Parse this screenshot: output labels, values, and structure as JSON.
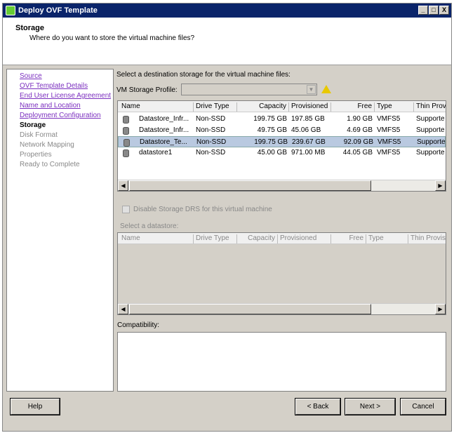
{
  "window": {
    "title": "Deploy OVF Template",
    "controls": [
      "_",
      "□",
      "X"
    ]
  },
  "header": {
    "title": "Storage",
    "subtitle": "Where do you want to store the virtual machine files?"
  },
  "nav": {
    "items": [
      {
        "label": "Source",
        "state": "link"
      },
      {
        "label": "OVF Template Details",
        "state": "link"
      },
      {
        "label": "End User License Agreement",
        "state": "link"
      },
      {
        "label": "Name and Location",
        "state": "link"
      },
      {
        "label": "Deployment Configuration",
        "state": "link"
      },
      {
        "label": "Storage",
        "state": "current"
      },
      {
        "label": "Disk Format",
        "state": "disabled"
      },
      {
        "label": "Network Mapping",
        "state": "disabled"
      },
      {
        "label": "Properties",
        "state": "disabled"
      },
      {
        "label": "Ready to Complete",
        "state": "disabled"
      }
    ]
  },
  "main": {
    "instruction": "Select a destination storage for the virtual machine files:",
    "profile_label": "VM Storage Profile:",
    "profile_value": "",
    "columns": [
      "Name",
      "Drive Type",
      "Capacity",
      "Provisioned",
      "Free",
      "Type",
      "Thin Prov"
    ],
    "rows": [
      {
        "name": "Datastore_Infr...",
        "drive": "Non-SSD",
        "capacity": "199.75 GB",
        "provisioned": "197.85 GB",
        "free": "1.90 GB",
        "type": "VMFS5",
        "thin": "Supporte",
        "selected": false
      },
      {
        "name": "Datastore_Infr...",
        "drive": "Non-SSD",
        "capacity": "49.75 GB",
        "provisioned": "45.06 GB",
        "free": "4.69 GB",
        "type": "VMFS5",
        "thin": "Supporte",
        "selected": false
      },
      {
        "name": "Datastore_Te...",
        "drive": "Non-SSD",
        "capacity": "199.75 GB",
        "provisioned": "239.67 GB",
        "free": "92.09 GB",
        "type": "VMFS5",
        "thin": "Supporte",
        "selected": true
      },
      {
        "name": "datastore1",
        "drive": "Non-SSD",
        "capacity": "45.00 GB",
        "provisioned": "971.00 MB",
        "free": "44.05 GB",
        "type": "VMFS5",
        "thin": "Supporte",
        "selected": false
      }
    ],
    "drs_label": "Disable Storage DRS for this virtual machine",
    "select_ds_label": "Select a datastore:",
    "columns2": [
      "Name",
      "Drive Type",
      "Capacity",
      "Provisioned",
      "Free",
      "Type",
      "Thin Provis"
    ],
    "compat_label": "Compatibility:"
  },
  "buttons": {
    "help": "Help",
    "back": "< Back",
    "next": "Next >",
    "cancel": "Cancel"
  }
}
